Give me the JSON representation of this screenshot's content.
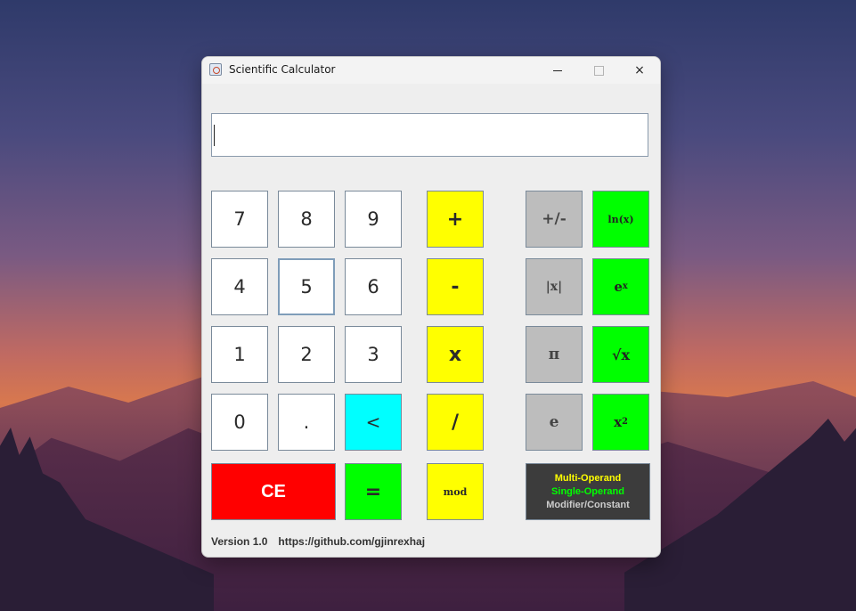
{
  "window": {
    "title": "Scientific Calculator",
    "controls": {
      "minimize": "minimize-icon",
      "maximize": "maximize-icon",
      "close": "×"
    }
  },
  "display": {
    "value": ""
  },
  "keypad": {
    "digits": [
      "7",
      "8",
      "9",
      "4",
      "5",
      "6",
      "1",
      "2",
      "3",
      "0",
      "."
    ],
    "backspace": "<",
    "clear": "CE",
    "equals": "="
  },
  "operators": {
    "add": "+",
    "subtract": "-",
    "multiply": "x",
    "divide": "/",
    "mod": "mod"
  },
  "modifiers": {
    "negate": "+/-",
    "abs": "|x|",
    "pi": "π",
    "e": "e"
  },
  "single_operand": {
    "ln": "ln(x)",
    "exp_base": "e",
    "exp_sup": "x",
    "sqrt": "√x",
    "square_base": "x",
    "square_sup": "2"
  },
  "legend": {
    "multi": "Multi-Operand",
    "single": "Single-Operand",
    "modifier": "Modifier/Constant",
    "colors": {
      "multi": "#ffff00",
      "single": "#00ff00",
      "modifier": "#cccccc"
    }
  },
  "footer": {
    "version": "Version 1.0",
    "url": "https://github.com/gjinrexhaj"
  }
}
